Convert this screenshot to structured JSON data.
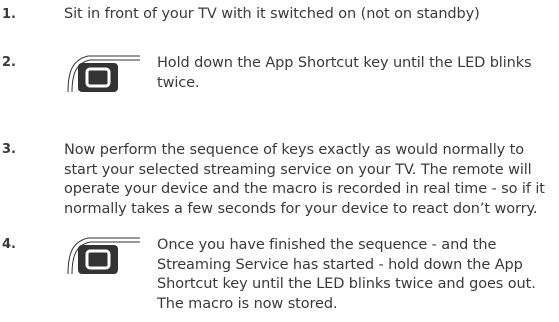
{
  "steps": [
    {
      "number": "1.",
      "text": "Sit in front of your TV with it switched on (not on standby)"
    },
    {
      "number": "2.",
      "text": "Hold down the App Shortcut key until the LED blinks twice.",
      "icon": "app-shortcut-key-icon"
    },
    {
      "number": "3.",
      "text": "Now perform the sequence of keys exactly as would normally to start your selected streaming service on your TV.  The remote will operate your device and the macro is recorded in real time - so if it normally takes a few seconds for your device to react don’t worry."
    },
    {
      "number": "4.",
      "text": "Once you have finished the sequence - and the Streaming Service has started - hold down the App Shortcut key until the LED blinks twice and goes out. The macro is now stored.",
      "icon": "app-shortcut-key-icon"
    }
  ],
  "colors": {
    "text": "#3a3a3a",
    "icon": "#333333"
  }
}
